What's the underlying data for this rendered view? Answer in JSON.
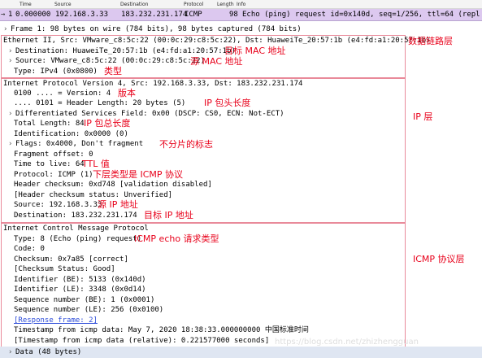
{
  "columns": {
    "no": "",
    "time": "Time",
    "source": "Source",
    "destination": "Destination",
    "protocol": "Protocol",
    "length": "Length",
    "info": "Info"
  },
  "packet": {
    "no": "1",
    "time": "0.000000",
    "source": "192.168.3.33",
    "destination": "183.232.231.174",
    "protocol": "ICMP",
    "length": "98",
    "info": "Echo (ping) request  id=0x140d, seq=1/256, ttl=64 (repl"
  },
  "frame": "Frame 1: 98 bytes on wire (784 bits), 98 bytes captured (784 bits)",
  "ethernet": {
    "header": "Ethernet II, Src: VMware_c8:5c:22 (00:0c:29:c8:5c:22), Dst: HuaweiTe_20:57:1b (e4:fd:a1:20:57:1b)",
    "destination": "Destination: HuaweiTe_20:57:1b (e4:fd:a1:20:57:1b)",
    "source": "Source: VMware_c8:5c:22 (00:0c:29:c8:5c:22)",
    "type": "Type: IPv4 (0x0800)"
  },
  "ip": {
    "header": "Internet Protocol Version 4, Src: 192.168.3.33, Dst: 183.232.231.174",
    "version": "0100 .... = Version: 4",
    "header_length": ".... 0101 = Header Length: 20 bytes (5)",
    "dsfield": "Differentiated Services Field: 0x00 (DSCP: CS0, ECN: Not-ECT)",
    "total_length": "Total Length: 84",
    "identification": "Identification: 0x0000 (0)",
    "flags": "Flags: 0x4000, Don't fragment",
    "frag_offset": "Fragment offset: 0",
    "ttl": "Time to live: 64",
    "protocol": "Protocol: ICMP (1)",
    "checksum": "Header checksum: 0xd748 [validation disabled]",
    "checksum_status": "[Header checksum status: Unverified]",
    "source": "Source: 192.168.3.33",
    "destination": "Destination: 183.232.231.174"
  },
  "icmp": {
    "header": "Internet Control Message Protocol",
    "type": "Type: 8 (Echo (ping) request)",
    "code": "Code: 0",
    "checksum": "Checksum: 0x7a85 [correct]",
    "checksum_status": "[Checksum Status: Good]",
    "id_be": "Identifier (BE): 5133 (0x140d)",
    "id_le": "Identifier (LE): 3348 (0x0d14)",
    "seq_be": "Sequence number (BE): 1 (0x0001)",
    "seq_le": "Sequence number (LE): 256 (0x0100)",
    "response": "[Response frame: 2]",
    "timestamp": "Timestamp from icmp data: May  7, 2020 18:38:33.000000000 中国标准时间",
    "timestamp_rel": "[Timestamp from icmp data (relative): 0.221577000 seconds]",
    "data": "Data (48 bytes)"
  },
  "annotations": {
    "datalink": "数据链路层",
    "dst_mac": "目标 MAC 地址",
    "src_mac": "源 MAC 地址",
    "type": "类型",
    "version": "版本",
    "ip_hdr_len": "IP 包头长度",
    "ip_total_len": "IP 包总长度",
    "no_frag": "不分片的标志",
    "ttl": "TTL 值",
    "upper": "下层类型是 ICMP 协议",
    "src_ip": "源 IP 地址",
    "dst_ip": "目标 IP 地址",
    "ip_layer": "IP 层",
    "icmp_type": "ICMP echo 请求类型",
    "icmp_layer": "ICMP 协议层"
  },
  "watermark": "https://blog.csdn.net/zhizhengguan",
  "colors": {
    "selected_row": "#dcc8ef",
    "annotation": "#e8001a",
    "link": "#2a4ad8"
  }
}
